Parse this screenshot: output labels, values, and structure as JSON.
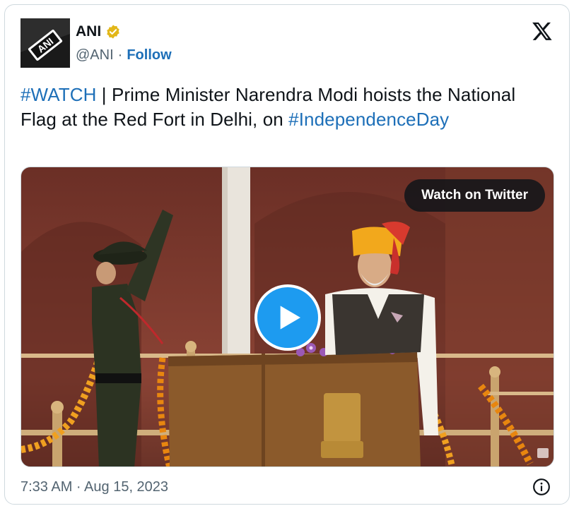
{
  "author": {
    "name": "ANI",
    "handle": "@ANI",
    "separator": "·",
    "follow_label": "Follow",
    "avatar_text": "ANI"
  },
  "tweet": {
    "hashtag1": "#WATCH",
    "text": " | Prime Minister Narendra Modi hoists the National Flag at the Red Fort in Delhi, on ",
    "hashtag2": "#IndependenceDay"
  },
  "media": {
    "watch_label": "Watch on Twitter"
  },
  "footer": {
    "timestamp": "7:33 AM · Aug 15, 2023"
  },
  "icons": {
    "verified": "verified-badge-icon",
    "brand": "x-logo-icon",
    "play": "play-icon",
    "info": "info-icon"
  },
  "colors": {
    "link": "#1d6fb8",
    "play_button": "#1d9bf0",
    "verified_gold": "#e2b719",
    "muted_text": "#536471"
  }
}
